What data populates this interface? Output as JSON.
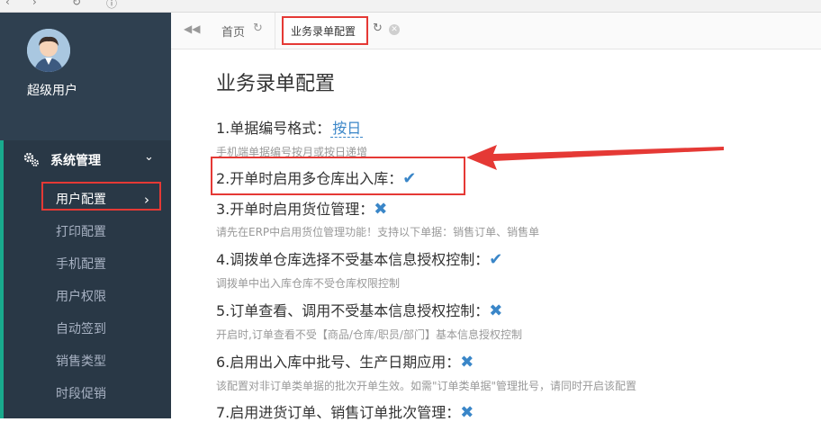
{
  "sidebar": {
    "username": "超级用户",
    "group_label": "系统管理",
    "items": [
      {
        "label": "用户配置",
        "active": true
      },
      {
        "label": "打印配置"
      },
      {
        "label": "手机配置"
      },
      {
        "label": "用户权限"
      },
      {
        "label": "自动签到"
      },
      {
        "label": "销售类型"
      },
      {
        "label": "时段促销"
      }
    ]
  },
  "tabs": {
    "home_label": "首页",
    "active_label": "业务录单配置"
  },
  "main": {
    "title": "业务录单配置",
    "options": [
      {
        "label": "1.单据编号格式：",
        "value": "按日",
        "desc": "手机端单据编号按月或按日递增"
      },
      {
        "label": "2.开单时启用多仓库出入库：",
        "state": "✔",
        "desc": ""
      },
      {
        "label": "3.开单时启用货位管理：",
        "state": "✖",
        "desc": "请先在ERP中启用货位管理功能！支持以下单据：销售订单、销售单"
      },
      {
        "label": "4.调拨单仓库选择不受基本信息授权控制：",
        "state": "✔",
        "desc": "调拨单中出入库仓库不受仓库权限控制"
      },
      {
        "label": "5.订单查看、调用不受基本信息授权控制：",
        "state": "✖",
        "desc": "开启时,订单查看不受【商品/仓库/职员/部门】基本信息授权控制"
      },
      {
        "label": "6.启用出入库中批号、生产日期应用：",
        "state": "✖",
        "desc": "该配置对非订单类单据的批次开单生效。如需\"订单类单据\"管理批号，请同时开启该配置"
      },
      {
        "label": "7.启用进货订单、销售订单批次管理：",
        "state": "✖",
        "desc": ""
      }
    ]
  },
  "colors": {
    "sidebar_bg": "#2f4050",
    "accent": "#3a86c8",
    "highlight_red": "#e53935"
  }
}
